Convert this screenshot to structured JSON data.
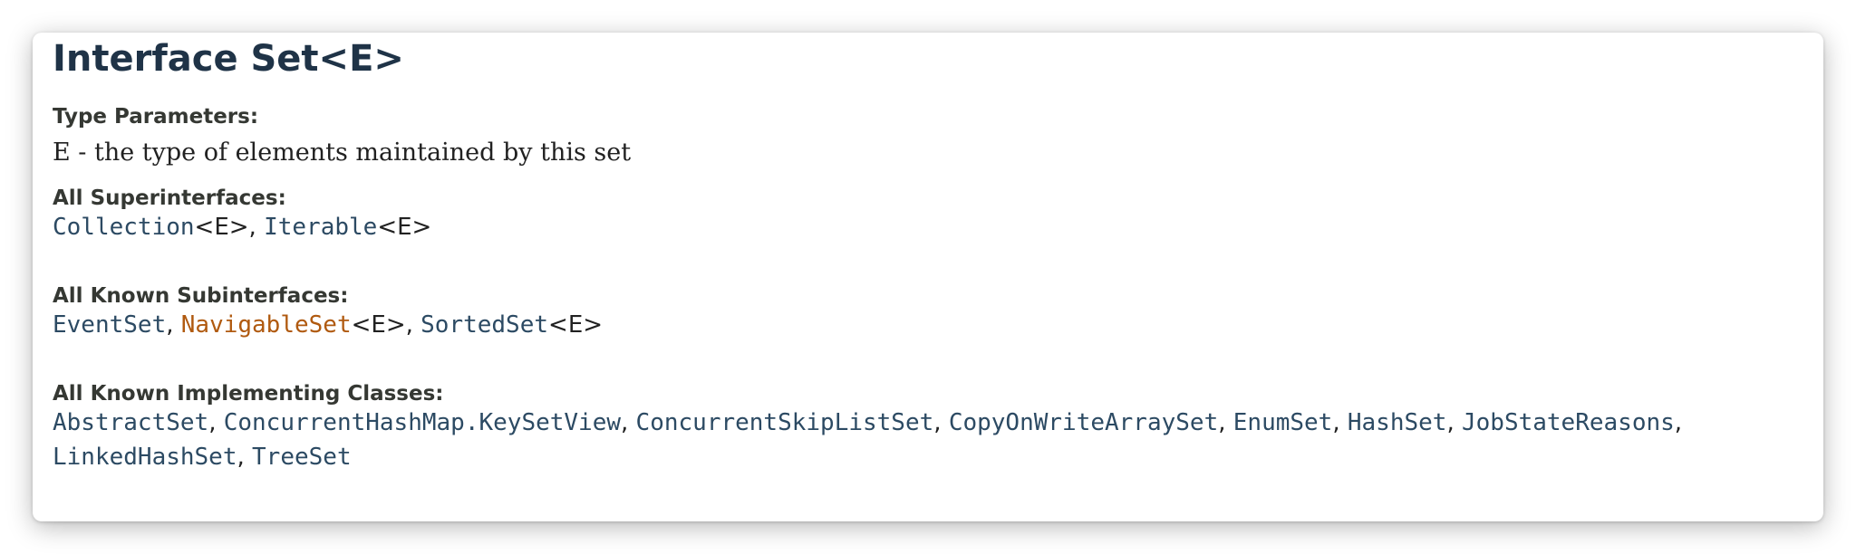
{
  "title": "Interface Set<E>",
  "type_parameters": {
    "label": "Type Parameters:",
    "text": "E - the type of elements maintained by this set"
  },
  "superinterfaces": {
    "label": "All Superinterfaces:",
    "items": [
      {
        "name": "Collection",
        "generic": "<E>",
        "sep": ", "
      },
      {
        "name": "Iterable",
        "generic": "<E>",
        "sep": ""
      }
    ]
  },
  "subinterfaces": {
    "label": "All Known Subinterfaces:",
    "items": [
      {
        "name": "EventSet",
        "generic": "",
        "sep": ", "
      },
      {
        "name": "NavigableSet",
        "generic": "<E>",
        "sep": ", "
      },
      {
        "name": "SortedSet",
        "generic": "<E>",
        "sep": ""
      }
    ]
  },
  "implementing_classes": {
    "label": "All Known Implementing Classes:",
    "items": [
      {
        "name": "AbstractSet",
        "sep": ", "
      },
      {
        "name": "ConcurrentHashMap.KeySetView",
        "sep": ", "
      },
      {
        "name": "ConcurrentSkipListSet",
        "sep": ", "
      },
      {
        "name": "CopyOnWriteArraySet",
        "sep": ", "
      },
      {
        "name": "EnumSet",
        "sep": ", "
      },
      {
        "name": "HashSet",
        "sep": ", "
      },
      {
        "name": "JobStateReasons",
        "sep": ","
      },
      {
        "name": "LinkedHashSet",
        "sep": ", "
      },
      {
        "name": "TreeSet",
        "sep": ""
      }
    ]
  },
  "colors": {
    "title": "#1f3347",
    "link": "#2c4a63",
    "visited_link": "#b05a10",
    "label": "#353833"
  }
}
